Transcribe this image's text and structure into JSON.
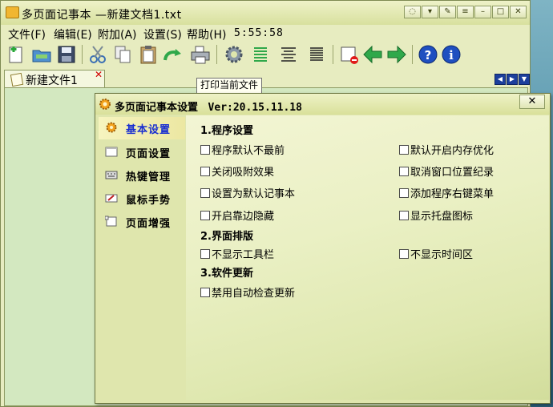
{
  "window": {
    "title": "多页面记事本 —新建文档1.txt",
    "clock": "5:55:58",
    "menu": [
      "文件(F)",
      "编辑(E)",
      "附加(A)",
      "设置(S)",
      "帮助(H)"
    ],
    "sys_buttons": [
      "chat-icon",
      "shirt-icon",
      "pin-icon",
      "menu-icon",
      "minimize-icon",
      "maximize-icon",
      "close-icon"
    ]
  },
  "toolbar": {
    "icons": [
      "new-icon",
      "open-icon",
      "save-icon",
      "cut-icon",
      "copy-icon",
      "paste-icon",
      "redo-icon",
      "print-icon",
      "settings-icon",
      "align-left-icon",
      "align-center-icon",
      "align-right-icon",
      "clear-icon",
      "back-icon",
      "forward-icon",
      "help-icon",
      "info-icon"
    ],
    "tooltip": "打印当前文件"
  },
  "tabs": [
    {
      "label": "新建文件1"
    }
  ],
  "dialog": {
    "title": "多页面记事本设置",
    "version": "Ver:20.15.11.18",
    "close": "✕",
    "sidebar": [
      {
        "label": "基本设置",
        "icon": "gear-icon"
      },
      {
        "label": "页面设置",
        "icon": "page-icon"
      },
      {
        "label": "热键管理",
        "icon": "keyboard-icon"
      },
      {
        "label": "鼠标手势",
        "icon": "mouse-gesture-icon"
      },
      {
        "label": "页面增强",
        "icon": "page-enhance-icon"
      }
    ],
    "sections": [
      {
        "title": "1.程序设置",
        "options": [
          {
            "label": "程序默认不最前",
            "checked": false
          },
          {
            "label": "默认开启内存优化",
            "checked": false
          },
          {
            "label": "关闭吸附效果",
            "checked": false
          },
          {
            "label": "取消窗口位置纪录",
            "checked": false
          },
          {
            "label": "设置为默认记事本",
            "checked": false
          },
          {
            "label": "添加程序右键菜单",
            "checked": false
          },
          {
            "label": "开启靠边隐藏",
            "checked": false
          },
          {
            "label": "显示托盘图标",
            "checked": false
          }
        ]
      },
      {
        "title": "2.界面排版",
        "options": [
          {
            "label": "不显示工具栏",
            "checked": false
          },
          {
            "label": "不显示时间区",
            "checked": false
          }
        ]
      },
      {
        "title": "3.软件更新",
        "options": [
          {
            "label": "禁用自动检查更新",
            "checked": false
          }
        ]
      }
    ]
  },
  "colors": {
    "accent_blue": "#1a2fd0",
    "close_red": "#d00000",
    "toolbar_green": "#2fa84a",
    "help_blue": "#1f4fc0"
  }
}
